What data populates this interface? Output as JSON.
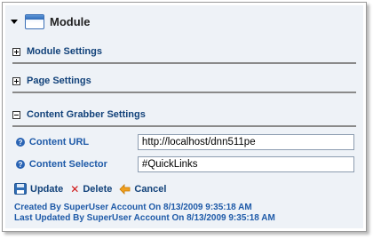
{
  "module": {
    "title": "Module"
  },
  "sections": [
    {
      "title": "Module Settings",
      "state": "collapsed"
    },
    {
      "title": "Page Settings",
      "state": "collapsed"
    },
    {
      "title": "Content Grabber Settings",
      "state": "expanded"
    }
  ],
  "fields": {
    "content_url": {
      "label": "Content URL",
      "value": "http://localhost/dnn511pe"
    },
    "content_selector": {
      "label": "Content Selector",
      "value": "#QuickLinks"
    }
  },
  "actions": {
    "update": "Update",
    "delete": "Delete",
    "cancel": "Cancel"
  },
  "audit": {
    "created": "Created By SuperUser Account On 8/13/2009 9:35:18 AM",
    "updated": "Last Updated By SuperUser Account On 8/13/2009 9:35:18 AM"
  },
  "colors": {
    "section_title": "#12427a",
    "label": "#1e5aa8",
    "panel_bg": "#eef2f7"
  }
}
